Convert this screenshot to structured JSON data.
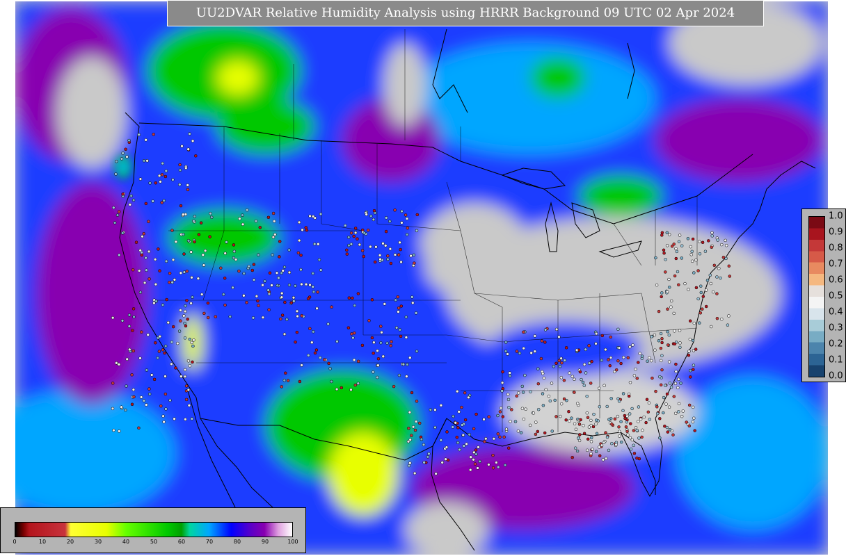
{
  "title": "UU2DVAR Relative Humidity Analysis using HRRR Background 09 UTC 02 Apr 2024",
  "rh_colorbar": {
    "ticks": [
      "0",
      "10",
      "20",
      "30",
      "40",
      "50",
      "60",
      "70",
      "80",
      "90",
      "100"
    ],
    "stops": [
      {
        "at": 0,
        "color": "#000000"
      },
      {
        "at": 3,
        "color": "#7a0000"
      },
      {
        "at": 5,
        "color": "#b3141c"
      },
      {
        "at": 18,
        "color": "#c8323c"
      },
      {
        "at": 20,
        "color": "#ffff33"
      },
      {
        "at": 33,
        "color": "#e8ff00"
      },
      {
        "at": 40,
        "color": "#66ff00"
      },
      {
        "at": 55,
        "color": "#00c800"
      },
      {
        "at": 60,
        "color": "#00a000"
      },
      {
        "at": 63,
        "color": "#00d6a0"
      },
      {
        "at": 70,
        "color": "#00a6ff"
      },
      {
        "at": 78,
        "color": "#0000ff"
      },
      {
        "at": 85,
        "color": "#5a00c8"
      },
      {
        "at": 90,
        "color": "#8800b0"
      },
      {
        "at": 95,
        "color": "#e0a0e0"
      },
      {
        "at": 100,
        "color": "#ffffff"
      }
    ]
  },
  "density_colorbar": {
    "ticks": [
      "1.0",
      "0.9",
      "0.8",
      "0.7",
      "0.6",
      "0.5",
      "0.4",
      "0.3",
      "0.2",
      "0.1",
      "0.0"
    ],
    "colors": [
      "#7a0a14",
      "#a8141e",
      "#c43838",
      "#d65a48",
      "#e88a60",
      "#f5b880",
      "#e6e0dc",
      "#f4f4f4",
      "#d8e4ec",
      "#a8ccd8",
      "#78acc4",
      "#4c84ac",
      "#2c6494",
      "#17426e"
    ]
  },
  "colors": {
    "land": "#c9c9c9",
    "ocean_deep": "#1b3cff",
    "ocean_blue": "#00a6ff",
    "moist_violet": "#8800b0",
    "dry_green": "#00c800",
    "very_dry_yellow": "#e8ff00",
    "boundary": "#000000"
  }
}
